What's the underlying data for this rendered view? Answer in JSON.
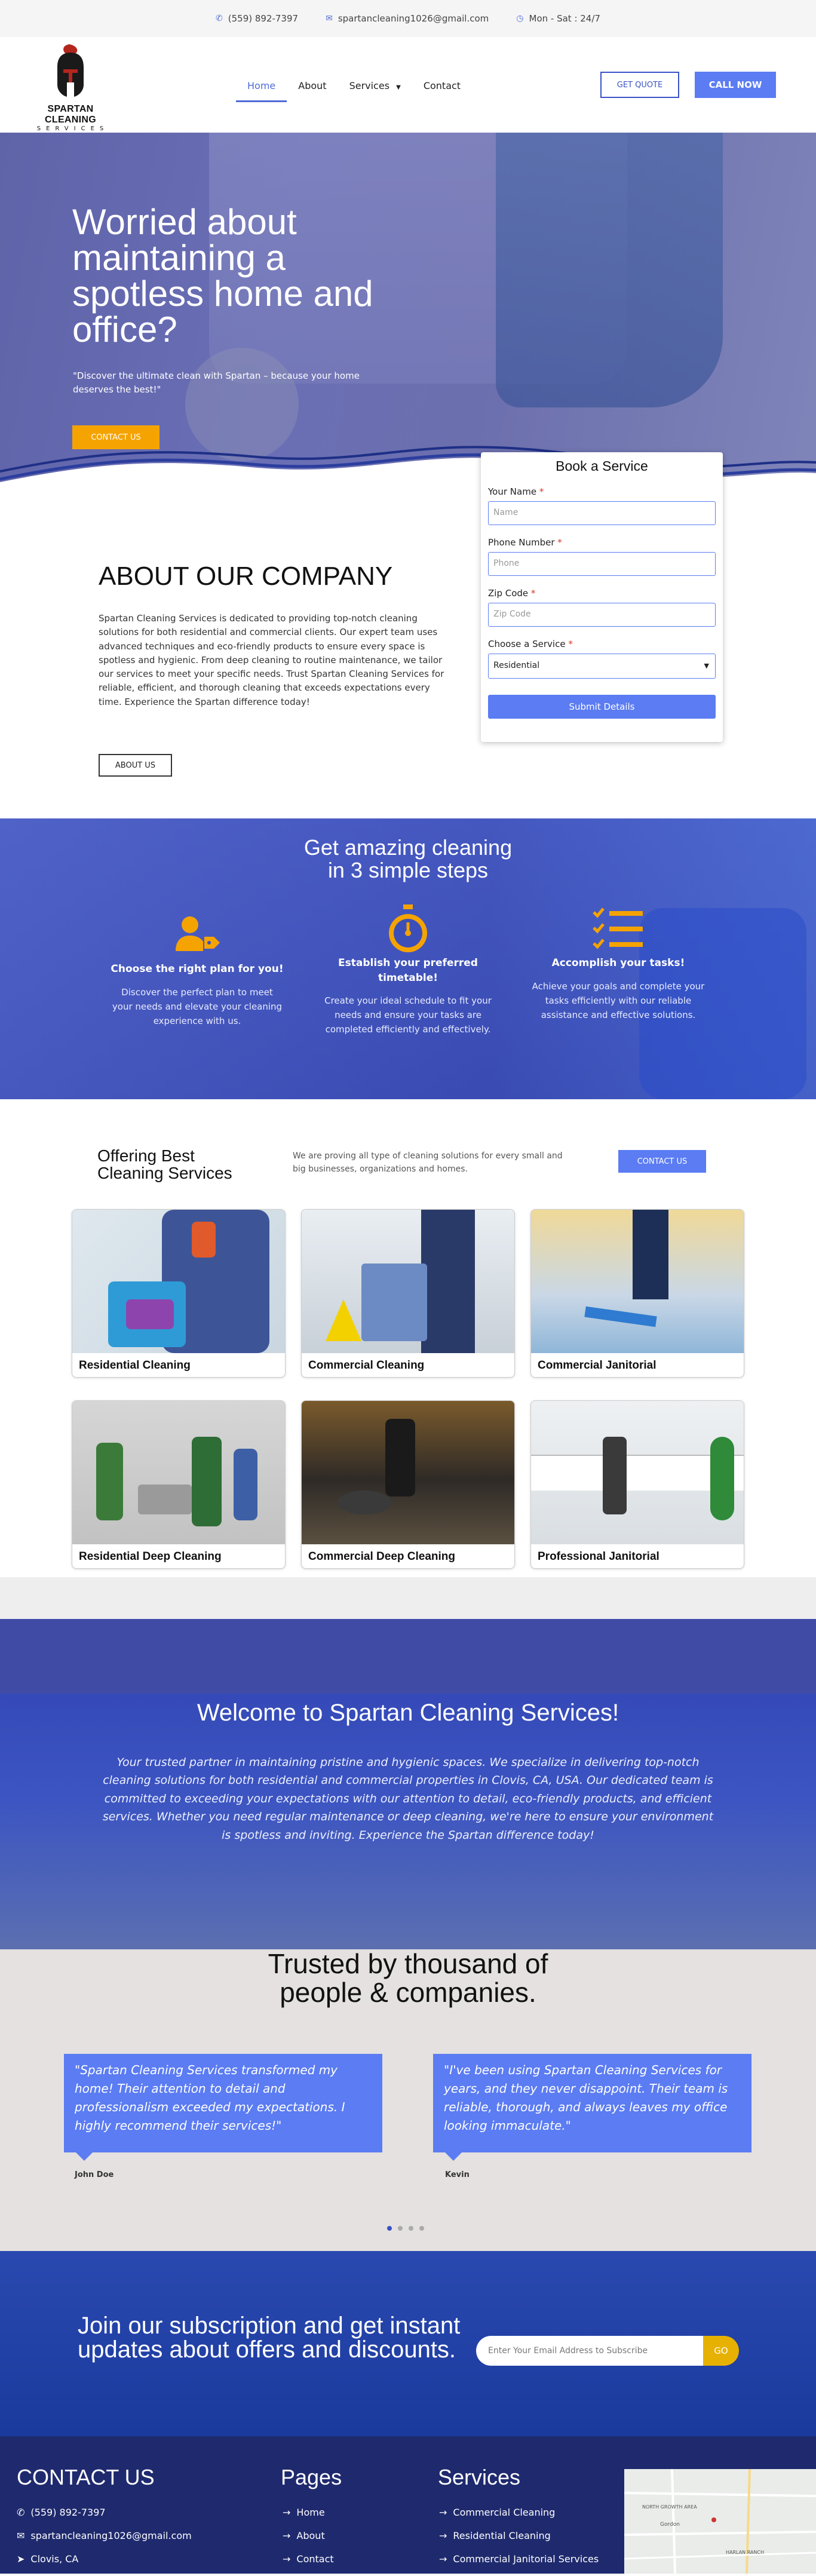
{
  "topbar": {
    "phone": "(559) 892-7397",
    "email": "spartancleaning1026@gmail.com",
    "hours": "Mon - Sat : 24/7"
  },
  "header": {
    "brand_name": "SPARTAN CLEANING",
    "brand_sub": "SERVICES",
    "nav": [
      "Home",
      "About",
      "Services",
      "Contact"
    ],
    "quote_button": "GET QUOTE",
    "call_button": "CALL NOW"
  },
  "hero": {
    "title": "Worried about maintaining a spotless home and office?",
    "subtitle": "\"Discover the ultimate clean with Spartan – because your home deserves the best!\"",
    "cta": "CONTACT US"
  },
  "booking_form": {
    "title": "Book a Service",
    "name_label": "Your Name",
    "name_placeholder": "Name",
    "phone_label": "Phone Number",
    "phone_placeholder": "Phone",
    "zip_label": "Zip Code",
    "zip_placeholder": "Zip Code",
    "service_label": "Choose a Service",
    "service_value": "Residential",
    "submit": "Submit Details",
    "required_mark": "*"
  },
  "about": {
    "title": "ABOUT OUR COMPANY",
    "body": "Spartan Cleaning Services is dedicated to providing top-notch cleaning solutions for both residential and commercial clients. Our expert team uses advanced techniques and eco-friendly products to ensure every space is spotless and hygienic. From deep cleaning to routine maintenance, we tailor our services to meet your specific needs. Trust Spartan Cleaning Services for reliable, efficient, and thorough cleaning that exceeds expectations every time. Experience the Spartan difference today!",
    "button": "ABOUT US"
  },
  "steps": {
    "title_line1": "Get amazing cleaning",
    "title_line2": "in 3 simple steps",
    "items": [
      {
        "icon": "user-tag-icon",
        "title": "Choose the right plan for you!",
        "body": "Discover the perfect plan to meet your needs and elevate your cleaning experience with us."
      },
      {
        "icon": "stopwatch-icon",
        "title": "Establish your preferred timetable!",
        "body": "Create your ideal schedule to fit your needs and ensure your tasks are completed efficiently and effectively."
      },
      {
        "icon": "checklist-icon",
        "title": "Accomplish your tasks!",
        "body": "Achieve your goals and complete your tasks efficiently with our reliable assistance and effective solutions."
      }
    ]
  },
  "offering": {
    "title_line1": "Offering Best",
    "title_line2": "Cleaning Services",
    "description": "We are proving all type of cleaning solutions for every small and big businesses, organizations and homes.",
    "button": "CONTACT US",
    "services": [
      "Residential Cleaning",
      "Commercial Cleaning",
      "Commercial Janitorial",
      "Residential Deep Cleaning",
      "Commercial Deep Cleaning",
      "Professional Janitorial"
    ]
  },
  "welcome": {
    "title": "Welcome to Spartan Cleaning Services!",
    "body": "Your trusted partner in maintaining pristine and hygienic spaces. We specialize in delivering top-notch cleaning solutions for both residential and commercial properties in Clovis, CA, USA. Our dedicated team is committed to exceeding your expectations with our attention to detail, eco-friendly products, and efficient services. Whether you need regular maintenance or deep cleaning, we're here to ensure your environment is spotless and inviting. Experience the Spartan difference today!"
  },
  "testimonials": {
    "title_line1": "Trusted by thousand of",
    "title_line2": "people & companies.",
    "items": [
      {
        "quote": "\"Spartan Cleaning Services transformed my home! Their attention to detail and professionalism exceeded my expectations. I highly recommend their services!\"",
        "name": "John Doe"
      },
      {
        "quote": "\"I've been using Spartan Cleaning Services for years, and they never disappoint. Their team is reliable, thorough, and always leaves my office looking immaculate.\"",
        "name": "Kevin"
      }
    ],
    "active_slide": 1,
    "slide_count": 4
  },
  "subscribe": {
    "title": "Join our subscription and get instant updates about offers and discounts.",
    "placeholder": "Enter Your Email Address to Subscribe",
    "button": "GO"
  },
  "footer": {
    "contact_title": "CONTACT US",
    "contact": [
      "(559) 892-7397",
      "spartancleaning1026@gmail.com",
      "Clovis, CA"
    ],
    "pages_title": "Pages",
    "pages": [
      "Home",
      "About",
      "Contact"
    ],
    "services_title": "Services",
    "services": [
      "Commercial Cleaning",
      "Residential Cleaning",
      "Commercial Janitorial Services"
    ],
    "map_labels": [
      "NORTH GROWTH AREA",
      "Gordon",
      "HARLAN RANCH"
    ]
  },
  "colors": {
    "accent": "#5b7cf2",
    "dark_blue": "#3a52c7",
    "orange": "#f5a300",
    "yellow": "#e6b100",
    "footer": "#1f2a6e"
  }
}
